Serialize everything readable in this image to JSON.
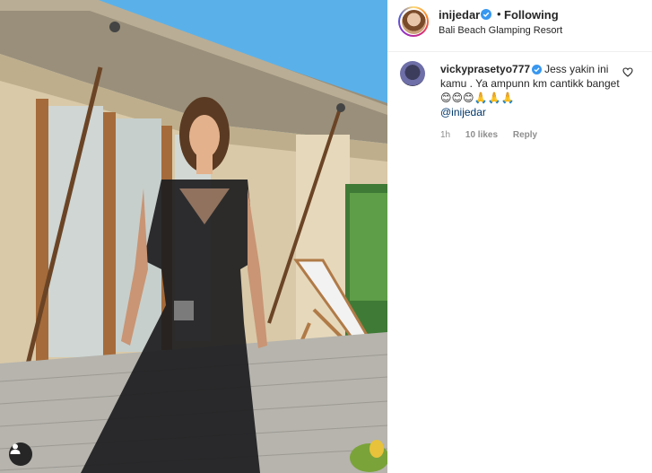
{
  "post": {
    "username": "inijedar",
    "separator": "•",
    "follow_label": "Following",
    "location": "Bali Beach Glamping Resort"
  },
  "comment": {
    "username": "vickyprasetyo777",
    "text": "Jess yakin ini kamu . Ya ampunn km cantikk banget",
    "emojis": [
      "😊",
      "😊",
      "😊",
      "🙏",
      "🙏",
      "🙏"
    ],
    "mention": "@inijedar",
    "time": "1h",
    "likes": "10 likes",
    "reply_label": "Reply"
  },
  "icons": {
    "verified": "verified-badge-icon",
    "heart": "heart-outline-icon",
    "tag": "user-tag-icon"
  },
  "colors": {
    "verified_blue": "#3897f0",
    "mention_blue": "#00376b",
    "meta_gray": "#8e8e8e"
  }
}
